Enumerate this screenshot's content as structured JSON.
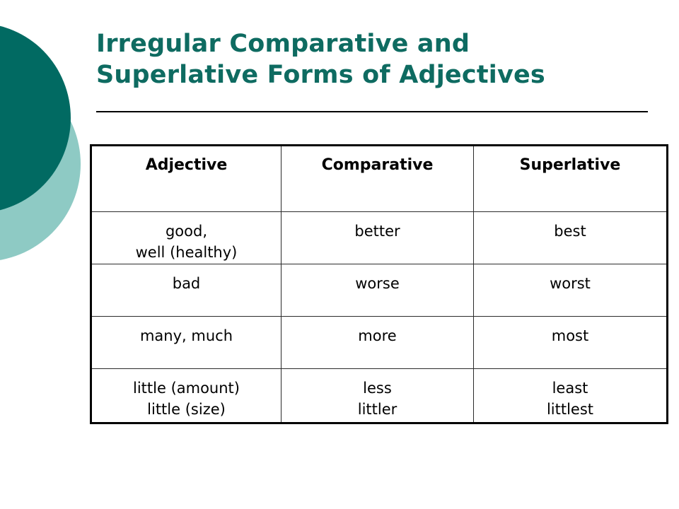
{
  "slide": {
    "title_line1": "Irregular Comparative and",
    "title_line2": "Superlative Forms of Adjectives",
    "title_color": "#0e6b61",
    "background_color": "#ffffff"
  },
  "decoration": {
    "dark_circle_color": "#016a62",
    "light_circle_color": "#8ecac4",
    "dark_circle_name": "dark-teal-circle",
    "light_circle_name": "light-teal-circle"
  },
  "table": {
    "headers": {
      "adjective": "Adjective",
      "comparative": "Comparative",
      "superlative": "Superlative"
    },
    "rows": [
      {
        "adjective_line1": "good,",
        "adjective_line2": "well (healthy)",
        "comparative_line1": "better",
        "comparative_line2": "",
        "superlative_line1": "best",
        "superlative_line2": ""
      },
      {
        "adjective_line1": "bad",
        "adjective_line2": "",
        "comparative_line1": "worse",
        "comparative_line2": "",
        "superlative_line1": "worst",
        "superlative_line2": ""
      },
      {
        "adjective_line1": "many, much",
        "adjective_line2": "",
        "comparative_line1": "more",
        "comparative_line2": "",
        "superlative_line1": "most",
        "superlative_line2": ""
      },
      {
        "adjective_line1": "little (amount)",
        "adjective_line2": "little (size)",
        "comparative_line1": "less",
        "comparative_line2": "littler",
        "superlative_line1": "least",
        "superlative_line2": "littlest"
      }
    ]
  }
}
